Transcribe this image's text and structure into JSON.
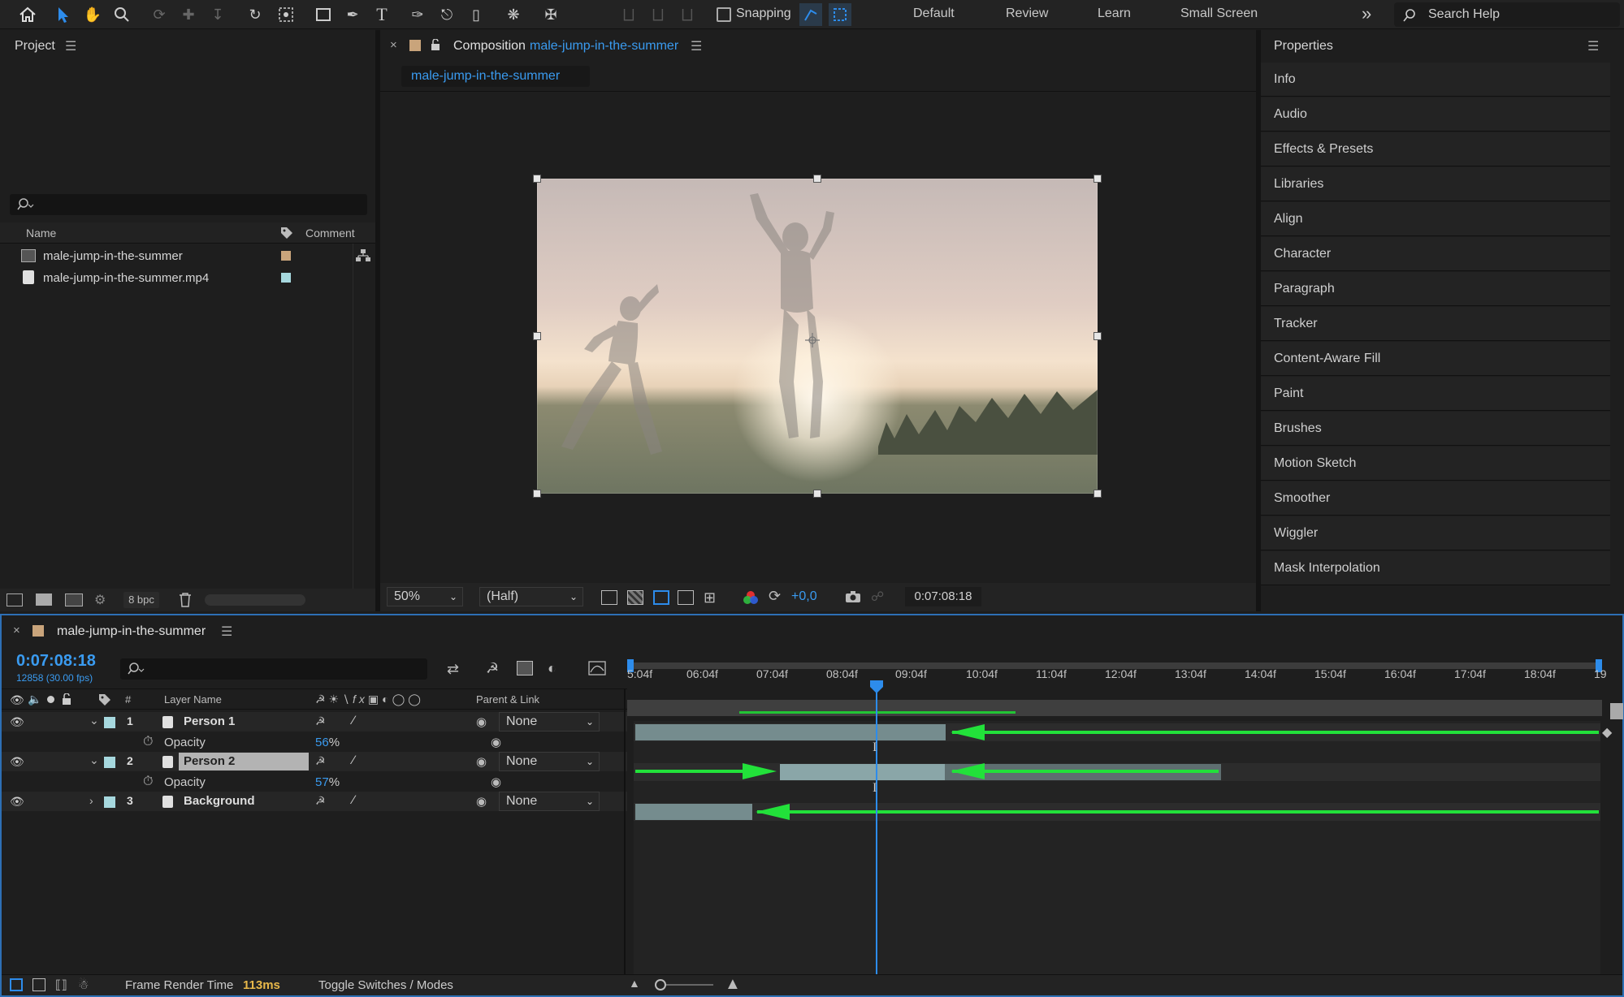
{
  "toolbar": {
    "snapping_label": "Snapping",
    "workspaces": [
      "Default",
      "Review",
      "Learn",
      "Small Screen"
    ],
    "search_placeholder": "Search Help"
  },
  "project": {
    "title": "Project",
    "columns": {
      "name": "Name",
      "comment": "Comment"
    },
    "items": [
      {
        "name": "male-jump-in-the-summer",
        "label_color": "#c9a47b",
        "type": "composition"
      },
      {
        "name": "male-jump-in-the-summer.mp4",
        "label_color": "#a6d8de",
        "type": "footage"
      }
    ],
    "bpc": "8 bpc"
  },
  "composition": {
    "title_prefix": "Composition",
    "name": "male-jump-in-the-summer",
    "tab": "male-jump-in-the-summer",
    "zoom": "50%",
    "resolution": "(Half)",
    "exposure": "+0,0",
    "timecode": "0:07:08:18"
  },
  "properties": {
    "title": "Properties",
    "items": [
      "Info",
      "Audio",
      "Effects & Presets",
      "Libraries",
      "Align",
      "Character",
      "Paragraph",
      "Tracker",
      "Content-Aware Fill",
      "Paint",
      "Brushes",
      "Motion Sketch",
      "Smoother",
      "Wiggler",
      "Mask Interpolation"
    ]
  },
  "timeline": {
    "comp_name": "male-jump-in-the-summer",
    "timecode": "0:07:08:18",
    "frame_info": "12858 (30.00 fps)",
    "columns": {
      "num": "#",
      "layer_name": "Layer Name",
      "parent": "Parent & Link"
    },
    "layers": [
      {
        "num": "1",
        "name": "Person 1",
        "parent": "None",
        "opacity_label": "Opacity",
        "opacity": "56",
        "unit": "%"
      },
      {
        "num": "2",
        "name": "Person 2",
        "parent": "None",
        "opacity_label": "Opacity",
        "opacity": "57",
        "unit": "%"
      },
      {
        "num": "3",
        "name": "Background",
        "parent": "None"
      }
    ],
    "ticks": [
      "5:04f",
      "06:04f",
      "07:04f",
      "08:04f",
      "09:04f",
      "10:04f",
      "11:04f",
      "12:04f",
      "13:04f",
      "14:04f",
      "15:04f",
      "16:04f",
      "17:04f",
      "18:04f",
      "19"
    ],
    "footer": {
      "render_label": "Frame Render Time",
      "render_value": "113ms",
      "toggle": "Toggle Switches / Modes"
    }
  }
}
